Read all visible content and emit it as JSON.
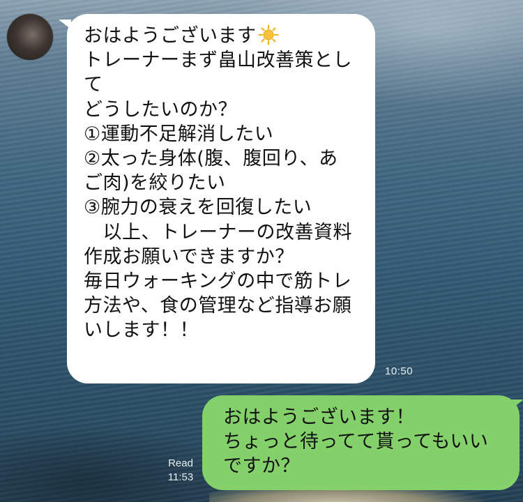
{
  "incoming_message": {
    "lines": [
      "おはようございます",
      "トレーナーまず畠山改善策とし",
      "て",
      "どうしたいのか？",
      "①運動不足解消したい",
      "②太った身体(腹、腹回り、あ",
      "ご肉)を絞りたい",
      "③腕力の衰えを回復したい",
      "　以上、トレーナーの改善資料",
      "作成お願いできますか？",
      "毎日ウォーキングの中で筋トレ",
      "方法や、食の管理など指導お願",
      "いします！！"
    ],
    "emoji": "sun-icon",
    "time": "10:50"
  },
  "outgoing_message": {
    "lines": [
      "おはようございます！",
      "ちょっと待ってて貰ってもいい",
      "ですか？"
    ],
    "read_label": "Read",
    "time": "11:53"
  },
  "colors": {
    "incoming_bubble": "#ffffff",
    "outgoing_bubble": "#84d16b",
    "timestamp": "#e8eef2"
  }
}
